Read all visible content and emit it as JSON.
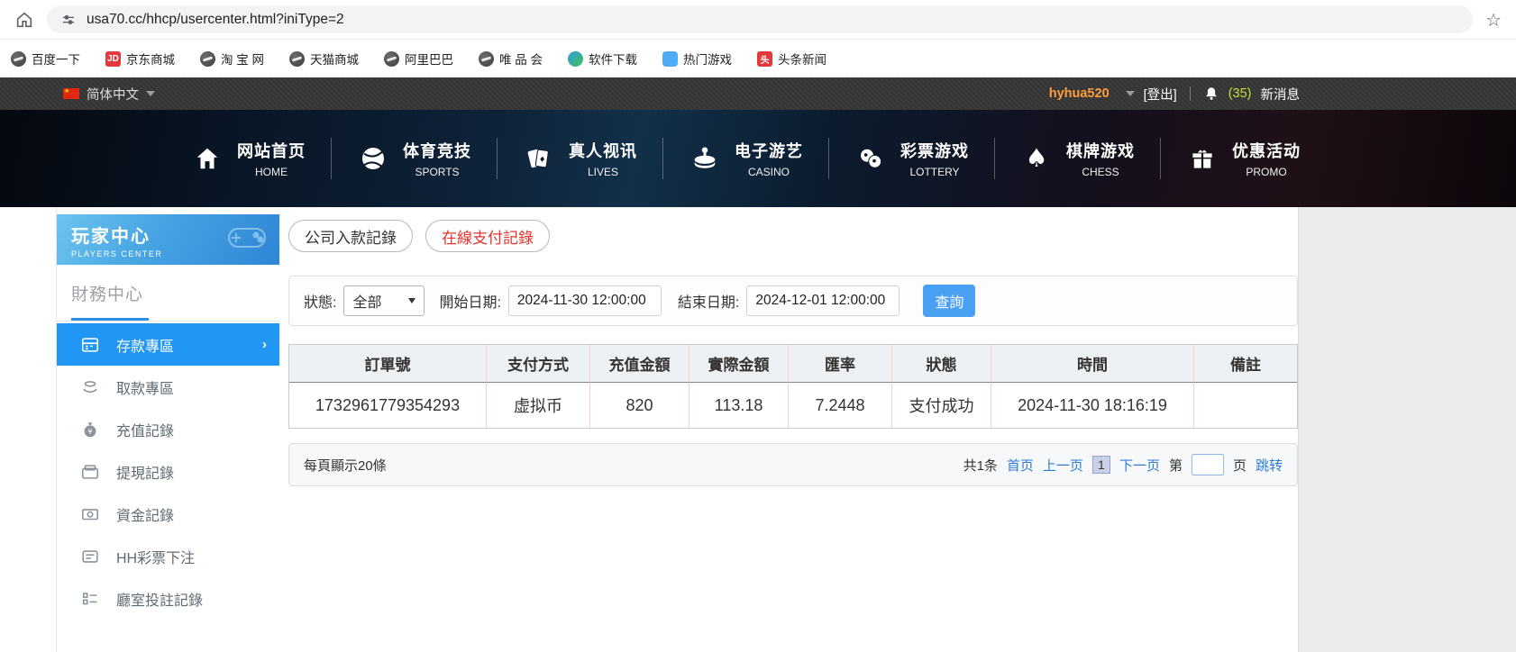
{
  "browser": {
    "url": "usa70.cc/hhcp/usercenter.html?iniType=2",
    "bookmarks": [
      {
        "label": "百度一下",
        "icon": "globe"
      },
      {
        "label": "京东商城",
        "icon": "jd",
        "icon_text": "JD"
      },
      {
        "label": "淘 宝 网",
        "icon": "globe"
      },
      {
        "label": "天猫商城",
        "icon": "globe"
      },
      {
        "label": "阿里巴巴",
        "icon": "globe"
      },
      {
        "label": "唯 品 会",
        "icon": "globe"
      },
      {
        "label": "软件下载",
        "icon": "download"
      },
      {
        "label": "热门游戏",
        "icon": "game"
      },
      {
        "label": "头条新闻",
        "icon": "toutiao",
        "icon_text": "头"
      }
    ]
  },
  "topbar": {
    "language": "简体中文",
    "username": "hyhua520",
    "logout": "[登出]",
    "message_count": "(35)",
    "message_label": "新消息"
  },
  "nav": {
    "items": [
      {
        "zh": "网站首页",
        "en": "HOME"
      },
      {
        "zh": "体育竞技",
        "en": "SPORTS"
      },
      {
        "zh": "真人视讯",
        "en": "LIVES"
      },
      {
        "zh": "电子游艺",
        "en": "CASINO"
      },
      {
        "zh": "彩票游戏",
        "en": "LOTTERY"
      },
      {
        "zh": "棋牌游戏",
        "en": "CHESS"
      },
      {
        "zh": "优惠活动",
        "en": "PROMO"
      }
    ]
  },
  "sidebar": {
    "title": "玩家中心",
    "subtitle": "PLAYERS CENTER",
    "section": "財務中心",
    "items": [
      {
        "label": "存款專區"
      },
      {
        "label": "取款專區"
      },
      {
        "label": "充值記錄"
      },
      {
        "label": "提現記錄"
      },
      {
        "label": "資金記錄"
      },
      {
        "label": "HH彩票下注"
      },
      {
        "label": "廳室投註記錄"
      }
    ]
  },
  "main": {
    "tabs": [
      {
        "label": "公司入款記錄"
      },
      {
        "label": "在線支付記錄"
      }
    ],
    "filter": {
      "status_label": "狀態:",
      "status_value": "全部",
      "start_label": "開始日期:",
      "start_value": "2024-11-30 12:00:00",
      "end_label": "結束日期:",
      "end_value": "2024-12-01 12:00:00",
      "search_button": "查詢"
    },
    "table": {
      "headers": [
        "訂單號",
        "支付方式",
        "充值金額",
        "實際金額",
        "匯率",
        "狀態",
        "時間",
        "備註"
      ],
      "rows": [
        [
          "1732961779354293",
          "虚拟币",
          "820",
          "113.18",
          "7.2448",
          "支付成功",
          "2024-11-30 18:16:19",
          ""
        ]
      ]
    },
    "pagination": {
      "page_size": "每頁顯示20條",
      "total": "共1条",
      "first": "首页",
      "prev": "上一页",
      "current": "1",
      "next": "下一页",
      "page_prefix": "第",
      "page_suffix": "页",
      "jump": "跳转"
    }
  }
}
